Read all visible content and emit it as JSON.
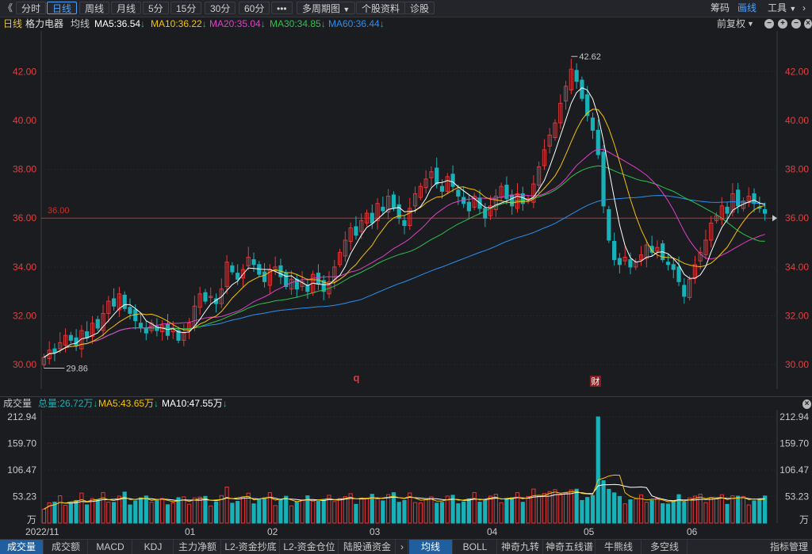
{
  "toolbar": {
    "back": "《",
    "tabs": [
      "分时",
      "日线",
      "周线",
      "月线",
      "5分",
      "15分",
      "30分",
      "60分"
    ],
    "more": "•••",
    "multi_period": "多周期图",
    "stock_info": "个股资料",
    "diagnose": "诊股",
    "right_chip": "筹码",
    "right_draw": "画线",
    "right_tools": "工具"
  },
  "info": {
    "period": "日线",
    "name": "格力电器",
    "indicator": "均线",
    "ma5": "MA5:36.54",
    "ma10": "MA10:36.22",
    "ma20": "MA20:35.04",
    "ma30": "MA30:34.85",
    "ma60": "MA60:36.44",
    "adjust": "前复权",
    "btn_minus": "−",
    "btn_plus": "+",
    "btn_minus2": "−",
    "btn_close": "×"
  },
  "colors": {
    "bg": "#1b1c20",
    "up": "#e0383b",
    "down": "#19b1b8",
    "ma5": "#ffffff",
    "ma10": "#f5c400",
    "ma20": "#e040c8",
    "ma30": "#2fc24a",
    "ma60": "#2a8ff0",
    "refline": "#c9302c",
    "axis_text": "#e04040"
  },
  "price_axis": {
    "ticks": [
      "42.00",
      "40.00",
      "38.00",
      "36.00",
      "34.00",
      "32.00",
      "30.00"
    ],
    "ylim": [
      29.0,
      43.6
    ],
    "ref_label": "36.00",
    "max_label": "42.62",
    "min_label": "29.86",
    "marker_q": "q",
    "marker_cai": "财"
  },
  "volume": {
    "label": "成交量",
    "total": "总量:26.72万",
    "ma5": "MA5:43.65万",
    "ma10": "MA10:47.55万",
    "ticks": [
      "212.94",
      "159.70",
      "106.47",
      "53.23",
      "万"
    ],
    "ylim": [
      0,
      212.94
    ]
  },
  "dates": [
    "2022/11",
    "01",
    "02",
    "03",
    "04",
    "05",
    "06"
  ],
  "bottom_tabs": [
    "成交量",
    "成交额",
    "MACD",
    "KDJ",
    "主力净额",
    "L2-资金抄底",
    "L2-资金仓位",
    "陆股通资金",
    "均线",
    "BOLL",
    "神奇九转",
    "神奇五线谱",
    "牛熊线",
    "多空线",
    "指标管理"
  ],
  "chart_data": {
    "type": "candlestick",
    "closes": [
      30.3,
      30.6,
      30.5,
      30.9,
      31.2,
      31.0,
      30.8,
      31.4,
      31.1,
      31.7,
      31.5,
      32.1,
      32.6,
      32.4,
      32.9,
      32.3,
      32.1,
      31.8,
      31.5,
      31.3,
      31.7,
      31.4,
      31.6,
      31.2,
      31.5,
      31.0,
      31.3,
      31.7,
      32.4,
      32.9,
      32.6,
      32.8,
      32.5,
      33.1,
      34.2,
      33.8,
      33.5,
      33.9,
      34.4,
      34.1,
      33.7,
      33.4,
      33.9,
      34.0,
      33.6,
      33.2,
      33.5,
      33.1,
      33.4,
      33.0,
      33.7,
      33.3,
      33.0,
      33.4,
      34.0,
      34.6,
      35.1,
      35.6,
      35.3,
      35.9,
      36.2,
      35.8,
      36.6,
      36.3,
      36.9,
      36.4,
      36.0,
      35.7,
      36.4,
      37.0,
      37.3,
      37.6,
      37.9,
      37.4,
      37.1,
      37.7,
      37.3,
      36.9,
      36.6,
      36.3,
      36.9,
      36.4,
      36.0,
      36.5,
      36.9,
      37.3,
      36.8,
      36.5,
      37.0,
      36.6,
      36.8,
      37.4,
      38.1,
      38.8,
      39.4,
      39.9,
      40.7,
      41.4,
      42.1,
      41.6,
      40.9,
      40.2,
      39.6,
      38.6,
      36.5,
      35.1,
      34.3,
      34.1,
      34.4,
      34.0,
      34.2,
      34.5,
      34.9,
      34.6,
      34.8,
      34.3,
      34.1,
      33.9,
      33.4,
      32.8,
      33.5,
      34.1,
      34.6,
      35.1,
      35.8,
      36.1,
      36.5,
      36.2,
      37.0,
      36.5,
      36.7,
      36.9,
      36.6,
      36.4,
      36.2
    ],
    "ma_series": [
      "MA5",
      "MA10",
      "MA20",
      "MA30",
      "MA60"
    ],
    "price_high": 42.62,
    "price_low": 29.86,
    "reference_price": 36.0,
    "volume_ma5": 43.65,
    "volume_ma10": 47.55,
    "total_volume": "26.72万"
  }
}
